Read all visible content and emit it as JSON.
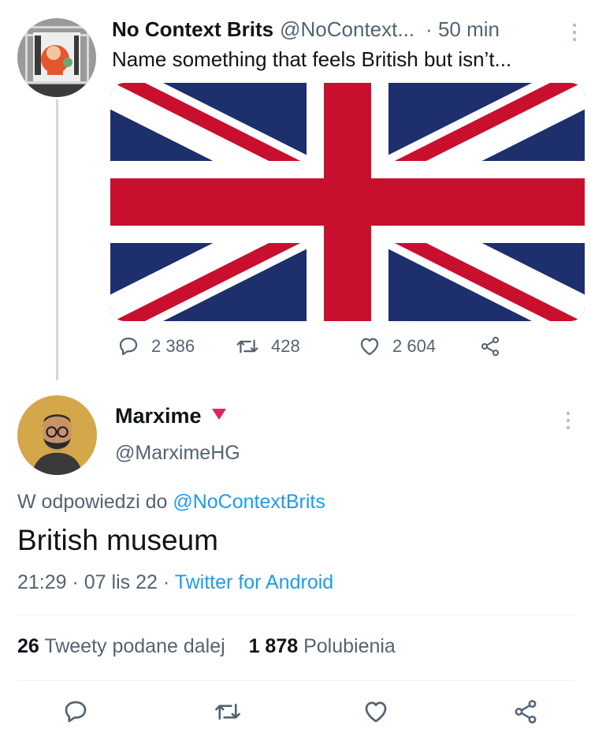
{
  "original_tweet": {
    "author_name": "No Context Brits",
    "handle": "@NoContext...",
    "separator": "·",
    "time": "50 min",
    "text": "Name something that feels British but isn’t...",
    "actions": {
      "replies": "2 386",
      "retweets": "428",
      "likes": "2 604"
    }
  },
  "reply_tweet": {
    "author_name": "Marxime",
    "handle": "@MarximeHG",
    "replying_to_prefix": "W odpowiedzi do",
    "replying_to_handle": "@NoContextBrits",
    "text": "British museum",
    "time": "21:29",
    "date": "07 lis 22",
    "separator": "·",
    "client": "Twitter for Android"
  },
  "stats": {
    "retweets_count": "26",
    "retweets_label": "Tweety podane dalej",
    "likes_count": "1 878",
    "likes_label": "Polubienia"
  },
  "icons": {
    "reply": "reply-icon",
    "retweet": "retweet-icon",
    "like": "heart-icon",
    "share": "share-icon",
    "more": "more-vertical-icon",
    "badge": "triangle-down-icon"
  },
  "colors": {
    "link": "#1d9bf0",
    "secondary_text": "#536471",
    "flag_blue": "#1e2f6d",
    "flag_red": "#c8102e",
    "badge": "#e0245e"
  }
}
